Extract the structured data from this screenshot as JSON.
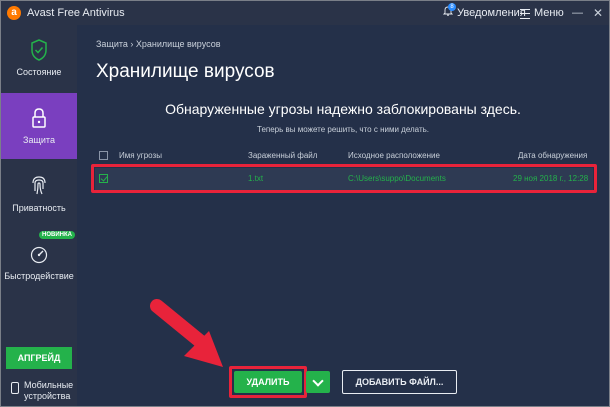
{
  "window": {
    "title": "Avast Free Antivirus",
    "logo_letter": "a",
    "updates_label": "Уведомления",
    "updates_count": "8",
    "menu_label": "Меню"
  },
  "sidebar": {
    "items": [
      {
        "label": "Состояние",
        "icon": "shield-check-icon"
      },
      {
        "label": "Защита",
        "icon": "lock-icon",
        "active": true
      },
      {
        "label": "Приватность",
        "icon": "fingerprint-icon"
      },
      {
        "label": "Быстродействие",
        "icon": "speedometer-icon",
        "badge": "НОВИНКА"
      }
    ],
    "upgrade_label": "АПГРЕЙД",
    "mobile_label_1": "Мобильные",
    "mobile_label_2": "устройства"
  },
  "main": {
    "breadcrumb": "Защита › Хранилище вирусов",
    "title": "Хранилище вирусов",
    "headline": "Обнаруженные угрозы надежно заблокированы здесь.",
    "subline": "Теперь вы можете решить, что с ними делать.",
    "table": {
      "columns": [
        "Имя угрозы",
        "Зараженный файл",
        "Исходное расположение",
        "Дата обнаружения"
      ],
      "rows": [
        {
          "threat": "",
          "file": "1.txt",
          "location": "C:\\Users\\suppo\\Documents",
          "date": "29 ноя 2018 г., 12:28",
          "checked": true
        }
      ]
    },
    "buttons": {
      "delete_label": "УДАЛИТЬ",
      "add_file_label": "ДОБАВИТЬ ФАЙЛ..."
    }
  },
  "colors": {
    "accent_green": "#24b24b",
    "active_purple": "#7a3fbf",
    "highlight_red": "#e8233a",
    "background": "#243049"
  }
}
